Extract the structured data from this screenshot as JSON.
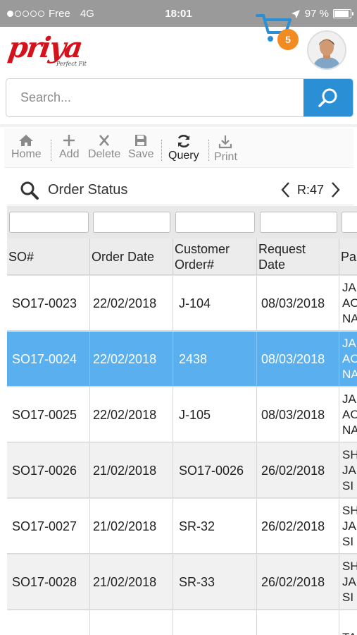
{
  "status_bar": {
    "carrier": "Free",
    "network": "4G",
    "time": "18:01",
    "battery": "97 %",
    "battery_level": 0.97,
    "signal_bars": 1
  },
  "header": {
    "logo_text": "priya",
    "logo_tagline": "Perfect Fit",
    "cart_count": "5",
    "accent_color": "#d3121c",
    "badge_color": "#f28b22"
  },
  "search": {
    "placeholder": "Search...",
    "value": "",
    "button_color": "#2b8fd6"
  },
  "toolbar": {
    "home": "Home",
    "add": "Add",
    "delete": "Delete",
    "save": "Save",
    "query": "Query",
    "print": "Print"
  },
  "panel": {
    "title": "Order Status",
    "record": "R:47"
  },
  "table": {
    "columns": [
      "SO#",
      "Order Date",
      "Customer Order#",
      "Request Date",
      "Pa"
    ],
    "column_lines": [
      [
        "SO#"
      ],
      [
        "Order Date"
      ],
      [
        "Customer",
        "Order#"
      ],
      [
        "Request",
        "Date"
      ],
      [
        "Pa"
      ]
    ],
    "rows": [
      {
        "so": "SO17-0023",
        "order_date": "22/02/2018",
        "customer_order": "J-104",
        "request_date": "08/03/2018",
        "party": [
          "JA",
          "AC",
          "NA"
        ]
      },
      {
        "so": "SO17-0024",
        "order_date": "22/02/2018",
        "customer_order": "2438",
        "request_date": "08/03/2018",
        "party": [
          "JA",
          "AC",
          "NA"
        ]
      },
      {
        "so": "SO17-0025",
        "order_date": "22/02/2018",
        "customer_order": "J-105",
        "request_date": "08/03/2018",
        "party": [
          "JA",
          "AC",
          "NA"
        ]
      },
      {
        "so": "SO17-0026",
        "order_date": "21/02/2018",
        "customer_order": "SO17-0026",
        "request_date": "26/02/2018",
        "party": [
          "SH",
          "JA",
          "SI"
        ]
      },
      {
        "so": "SO17-0027",
        "order_date": "21/02/2018",
        "customer_order": "SR-32",
        "request_date": "26/02/2018",
        "party": [
          "SH",
          "JA",
          "SI"
        ]
      },
      {
        "so": "SO17-0028",
        "order_date": "21/02/2018",
        "customer_order": "SR-33",
        "request_date": "26/02/2018",
        "party": [
          "SH",
          "JA",
          "SI"
        ]
      },
      {
        "so": "",
        "order_date": "",
        "customer_order": "",
        "request_date": "",
        "party": [
          "TA"
        ]
      }
    ],
    "selected_row": 1,
    "selected_color": "#5aafee"
  }
}
